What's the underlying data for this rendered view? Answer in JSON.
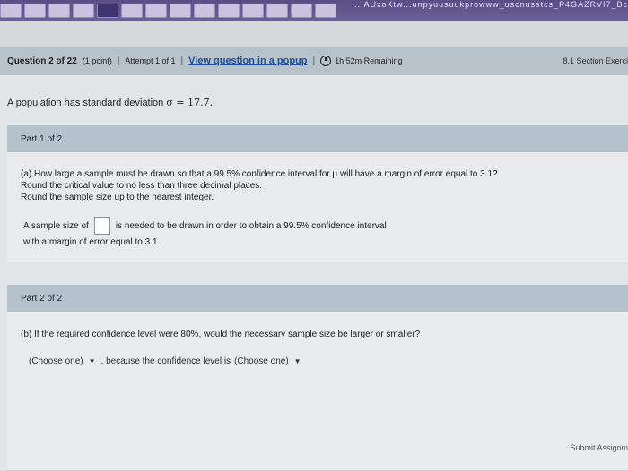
{
  "browser": {
    "url_fragment": "...AUxoKtw...unpyuusuukprowww_uscnusstcs_P4GAZRVI7_Bc"
  },
  "question_bar": {
    "question": "Question 2 of 22",
    "points": "(1 point)",
    "attempt": "Attempt 1 of 1",
    "popup_link": "View question in a popup",
    "timer": "1h 52m Remaining",
    "section": "8.1 Section Exerci"
  },
  "prompt": {
    "text_before": "A population has standard deviation ",
    "sigma": "σ = 17.7."
  },
  "part1": {
    "header": "Part 1 of 2",
    "question_line1": "(a) How large a sample must be drawn so that a 99.5% confidence interval for μ will have a margin of error equal to 3.1?",
    "question_line2": "Round the critical value to no less than three decimal places.",
    "question_line3": "Round the sample size up to the nearest integer.",
    "answer_before": "A sample size of",
    "answer_after": "is needed to be drawn in order to obtain a 99.5% confidence interval",
    "answer_line2": "with a margin of error equal to 3.1."
  },
  "part2": {
    "header": "Part 2 of 2",
    "question": "(b) If the required confidence level were 80%, would the necessary sample size be larger or smaller?",
    "choose1": "(Choose one)",
    "middle_text": ", because the confidence level is",
    "choose2": "(Choose one)"
  },
  "footer": {
    "submit": "Submit Assignm"
  }
}
